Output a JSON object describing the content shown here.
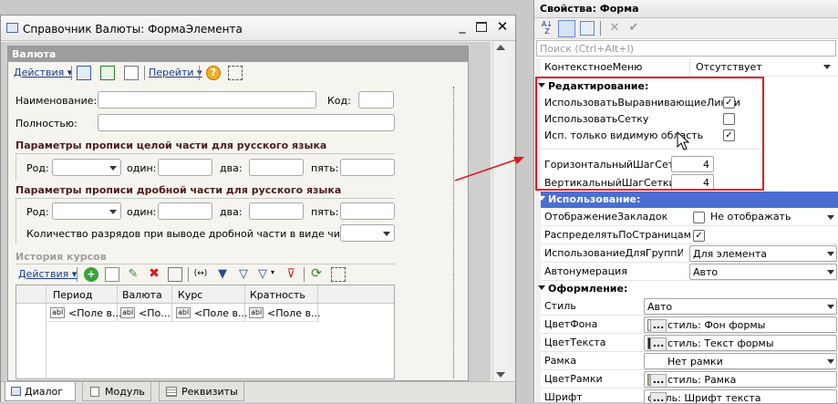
{
  "form_window": {
    "title": "Справочник Валюты: ФормаЭлемента",
    "form_header": "Валюта",
    "toolbar": {
      "actions": "Действия",
      "go": "Перейти"
    },
    "fields": {
      "name_label": "Наименование:",
      "code_label": "Код:",
      "full_label": "Полностью:"
    },
    "group_integer": {
      "title": "Параметры прописи целой части для русского языка",
      "gender_label": "Род:",
      "one_label": "один:",
      "two_label": "два:",
      "five_label": "пять:"
    },
    "group_fraction": {
      "title": "Параметры прописи дробной части для русского языка",
      "gender_label": "Род:",
      "one_label": "один:",
      "two_label": "два:",
      "five_label": "пять:",
      "digits_label": "Количество разрядов при выводе дробной части в виде числа:"
    },
    "history": {
      "title": "История курсов",
      "actions": "Действия",
      "columns": [
        "Период",
        "Валюта",
        "Курс",
        "Кратность"
      ],
      "cells": [
        "<Поле в...",
        "<По...",
        "<Поле в...",
        "<Поле в..."
      ]
    },
    "tabs": [
      "Диалог",
      "Модуль",
      "Реквизиты"
    ]
  },
  "properties": {
    "title": "Свойства: Форма",
    "search_placeholder": "Поиск (Ctrl+Alt+I)",
    "top_row": {
      "name": "КонтекстноеМеню",
      "value": "Отсутствует"
    },
    "sections": {
      "editing": "Редактирование:",
      "usage": "Использование:",
      "design": "Оформление:"
    },
    "editing_rows": [
      {
        "name": "ИспользоватьВыравнивающиеЛинии",
        "checked": true
      },
      {
        "name": "ИспользоватьСетку",
        "checked": false
      },
      {
        "name": "Исп. только видимую область",
        "checked": true
      }
    ],
    "grid_rows": [
      {
        "name": "ГоризонтальныйШагСетки",
        "value": "4"
      },
      {
        "name": "ВертикальныйШагСетки",
        "value": "4"
      }
    ],
    "usage_rows": [
      {
        "name": "ОтображениеЗакладок",
        "value": "Не отображать"
      },
      {
        "name": "РаспределятьПоСтраницам",
        "value": ""
      },
      {
        "name": "ИспользованиеДляГруппИЭле",
        "value": "Для элемента"
      },
      {
        "name": "Автонумерация",
        "value": "Авто"
      }
    ],
    "design_rows": [
      {
        "name": "Стиль",
        "value": "Авто"
      },
      {
        "name": "ЦветФона",
        "value": "стиль: Фон формы",
        "swatch": "#f6f4ee"
      },
      {
        "name": "ЦветТекста",
        "value": "стиль: Текст формы",
        "swatch": "#3a2608"
      },
      {
        "name": "Рамка",
        "value": "Нет рамки"
      },
      {
        "name": "ЦветРамки",
        "value": "стиль: Рамка",
        "swatch": "#b8b29a"
      },
      {
        "name": "Шрифт",
        "value": "стиль: Шрифт текста"
      }
    ]
  },
  "colors": {
    "highlight_frame": "#e2141b",
    "section_active": "#4a6fd1",
    "group_title": "#4a1e1e"
  }
}
